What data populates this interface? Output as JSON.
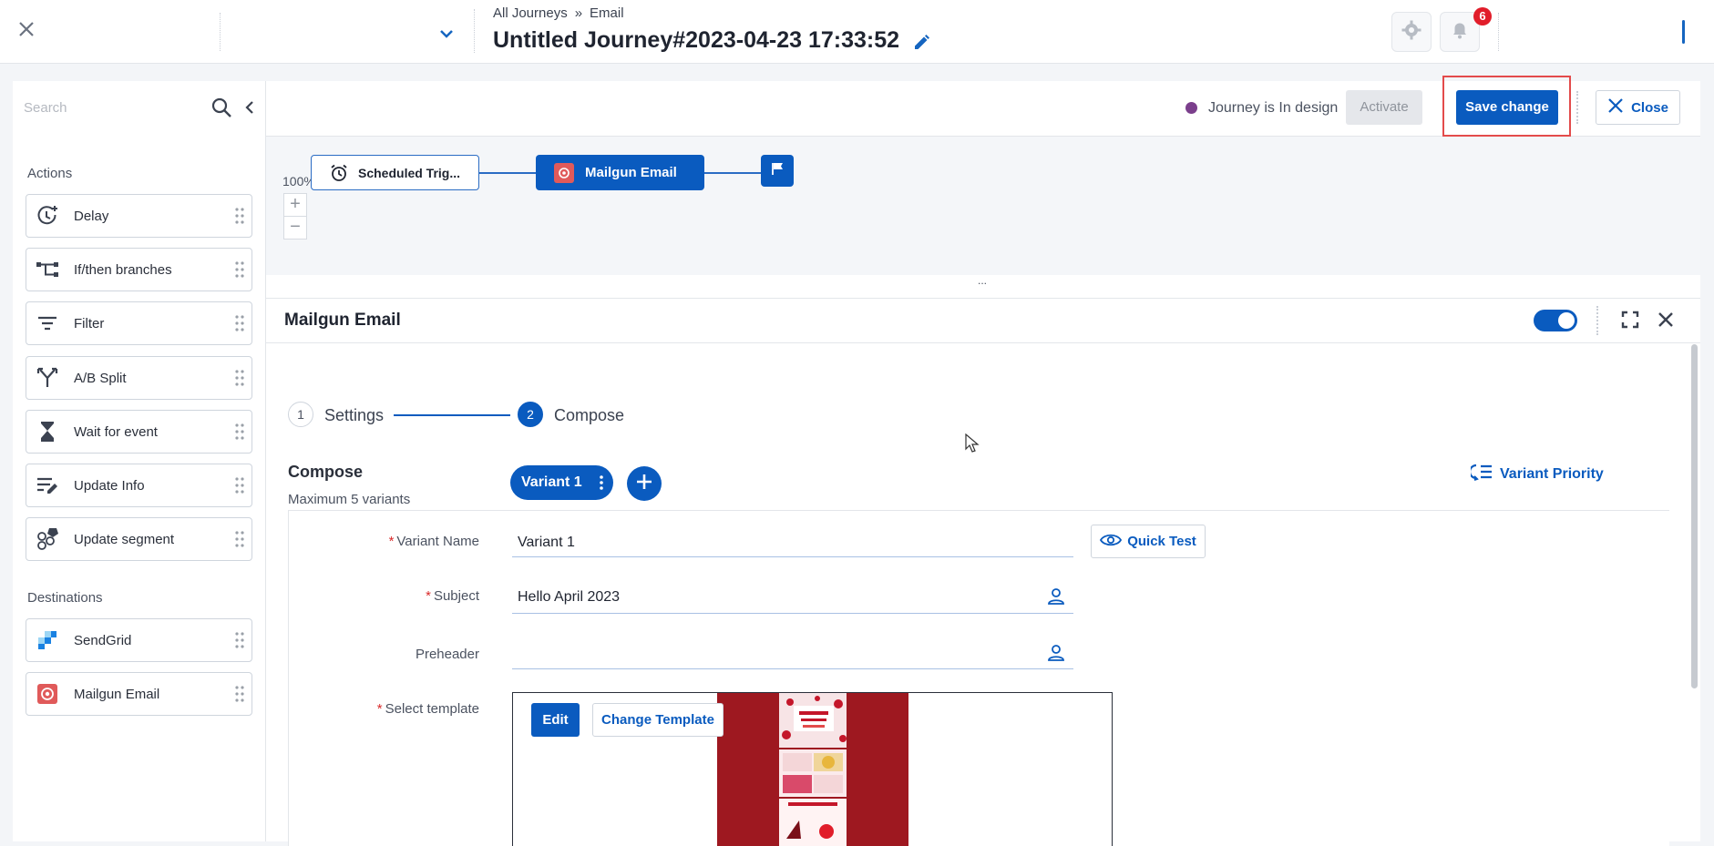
{
  "topbar": {
    "breadcrumb": [
      "All Journeys",
      "»",
      "Email"
    ],
    "title": "Untitled Journey#2023-04-23 17:33:52",
    "notification_count": "6",
    "icons": [
      "close-icon",
      "chevron-down-icon",
      "pencil-icon",
      "gear-icon",
      "bell-icon"
    ]
  },
  "sidebar": {
    "search_placeholder": "Search",
    "actions_label": "Actions",
    "actions": [
      {
        "label": "Delay",
        "icon": "clock-plus-icon"
      },
      {
        "label": "If/then branches",
        "icon": "branch-icon"
      },
      {
        "label": "Filter",
        "icon": "filter-icon"
      },
      {
        "label": "A/B Split",
        "icon": "split-icon"
      },
      {
        "label": "Wait for event",
        "icon": "hourglass-icon"
      },
      {
        "label": "Update Info",
        "icon": "edit-lines-icon"
      },
      {
        "label": "Update segment",
        "icon": "segment-icon"
      }
    ],
    "destinations_label": "Destinations",
    "destinations": [
      {
        "label": "SendGrid",
        "icon": "sendgrid-icon"
      },
      {
        "label": "Mailgun Email",
        "icon": "mailgun-icon"
      }
    ]
  },
  "toolbar": {
    "status_text": "Journey is In design",
    "status_color": "#7b3f8c",
    "activate_label": "Activate",
    "save_label": "Save change",
    "close_label": "Close"
  },
  "canvas": {
    "zoom": "100%",
    "zoom_in": "+",
    "zoom_out": "−",
    "nodes": {
      "trigger": "Scheduled Trig...",
      "mailgun": "Mailgun Email"
    },
    "resize_handle": "..."
  },
  "panel": {
    "title": "Mailgun Email",
    "steps": [
      {
        "number": "1",
        "label": "Settings"
      },
      {
        "number": "2",
        "label": "Compose"
      }
    ],
    "compose_title": "Compose",
    "compose_sub": "Maximum 5 variants",
    "variant_tab": "Variant 1",
    "variant_priority": "Variant Priority",
    "quick_test": "Quick Test",
    "fields": {
      "variant_name_label": "Variant Name",
      "variant_name_value": "Variant 1",
      "subject_label": "Subject",
      "subject_value": "Hello April 2023",
      "preheader_label": "Preheader",
      "preheader_value": "",
      "template_label": "Select template"
    },
    "template": {
      "edit_label": "Edit",
      "change_label": "Change Template"
    }
  },
  "colors": {
    "accent": "#0a5bbf",
    "highlight": "#e34b4b",
    "template_bg": "#9e1820"
  }
}
